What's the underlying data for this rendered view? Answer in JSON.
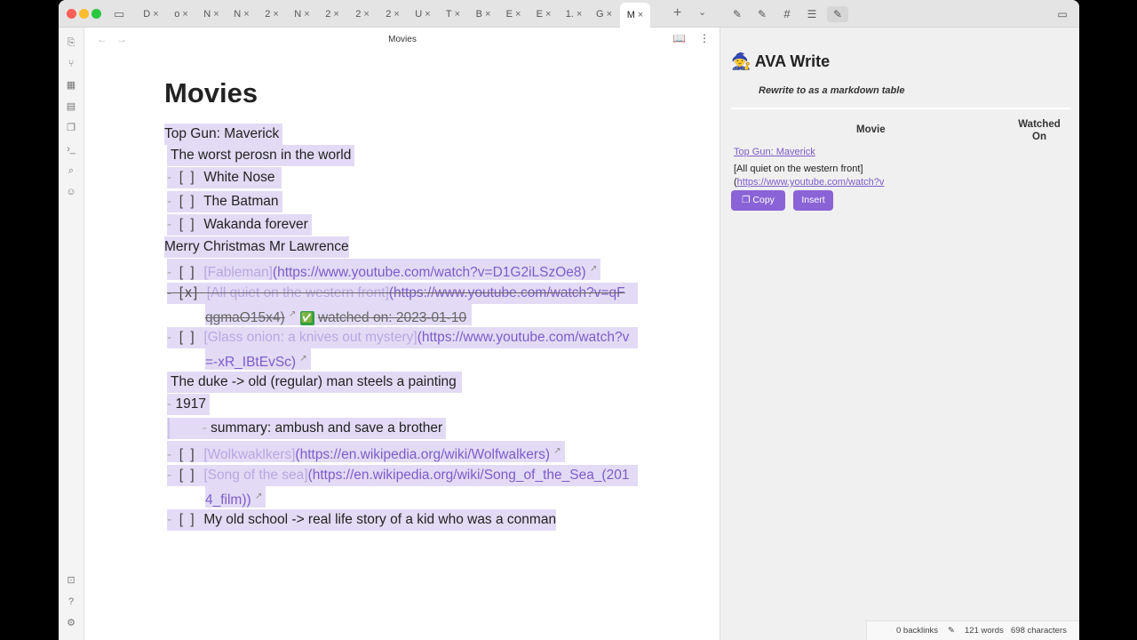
{
  "tabs": [
    {
      "label": "D"
    },
    {
      "label": "o"
    },
    {
      "label": "N"
    },
    {
      "label": "N"
    },
    {
      "label": "2"
    },
    {
      "label": "N"
    },
    {
      "label": "2"
    },
    {
      "label": "2"
    },
    {
      "label": "2"
    },
    {
      "label": "U"
    },
    {
      "label": "T"
    },
    {
      "label": "B"
    },
    {
      "label": "E"
    },
    {
      "label": "E"
    },
    {
      "label": "1."
    },
    {
      "label": "G"
    },
    {
      "label": "M"
    }
  ],
  "tab_close": "×",
  "new_tab": "+",
  "editor": {
    "header_title": "Movies",
    "doc_title": "Movies",
    "lines": {
      "l1": "Top Gun: Maverick",
      "l2": "The worst perosn in the world",
      "l3": "White Nose",
      "l4": "The Batman",
      "l5": "Wakanda forever",
      "l6": "Merry Christmas Mr Lawrence",
      "l7_text": "Fableman",
      "l7_url": "(https://www.youtube.com/watch?v=D1G2iLSzOe8)",
      "l8_text": "All quiet on the western front",
      "l8_url_a": "(https://www.youtube.com/watch?v=qF",
      "l8_url_b": "qgmaO15x4)",
      "l8_check": "✅",
      "l8_watched": "watched on: 2023-01-10",
      "l9_text": "Glass onion: a knives out mystery",
      "l9_url_a": "(https://www.youtube.com/watch?v",
      "l9_url_b": "=-xR_IBtEvSc)",
      "l10": "The duke -> old (regular) man steels a painting",
      "l11": "1917",
      "l12": "summary: ambush and save a brother",
      "l13_text": "Wolkwaklkers",
      "l13_url": "(https://en.wikipedia.org/wiki/Wolfwalkers)",
      "l14_text": "Song of the sea",
      "l14_url_a": "(https://en.wikipedia.org/wiki/Song_of_the_Sea_(201",
      "l14_url_b": "4_film))",
      "l15": "My old school -> real life story of a kid who was a conman"
    },
    "checkbox_empty": "[ ]",
    "checkbox_done": "[x]",
    "bullet": "-"
  },
  "ava": {
    "emoji": "🧙",
    "title": "AVA Write",
    "prompt": "Rewrite to as a markdown table",
    "col_movie": "Movie",
    "col_watched": "Watched On",
    "row1": "Top Gun: Maverick",
    "row2_text": "[All quiet on the western front]",
    "row2_link": "https://www.youtube.com/watch?v",
    "row2_paren": "(",
    "copy_label": "Copy",
    "insert_label": "Insert"
  },
  "status": {
    "backlinks": "0 backlinks",
    "words": "121 words",
    "chars": "698 characters"
  },
  "colors": {
    "accent": "#8a64d6",
    "highlight": "#e3dbf5",
    "link": "#7b5cc9"
  }
}
